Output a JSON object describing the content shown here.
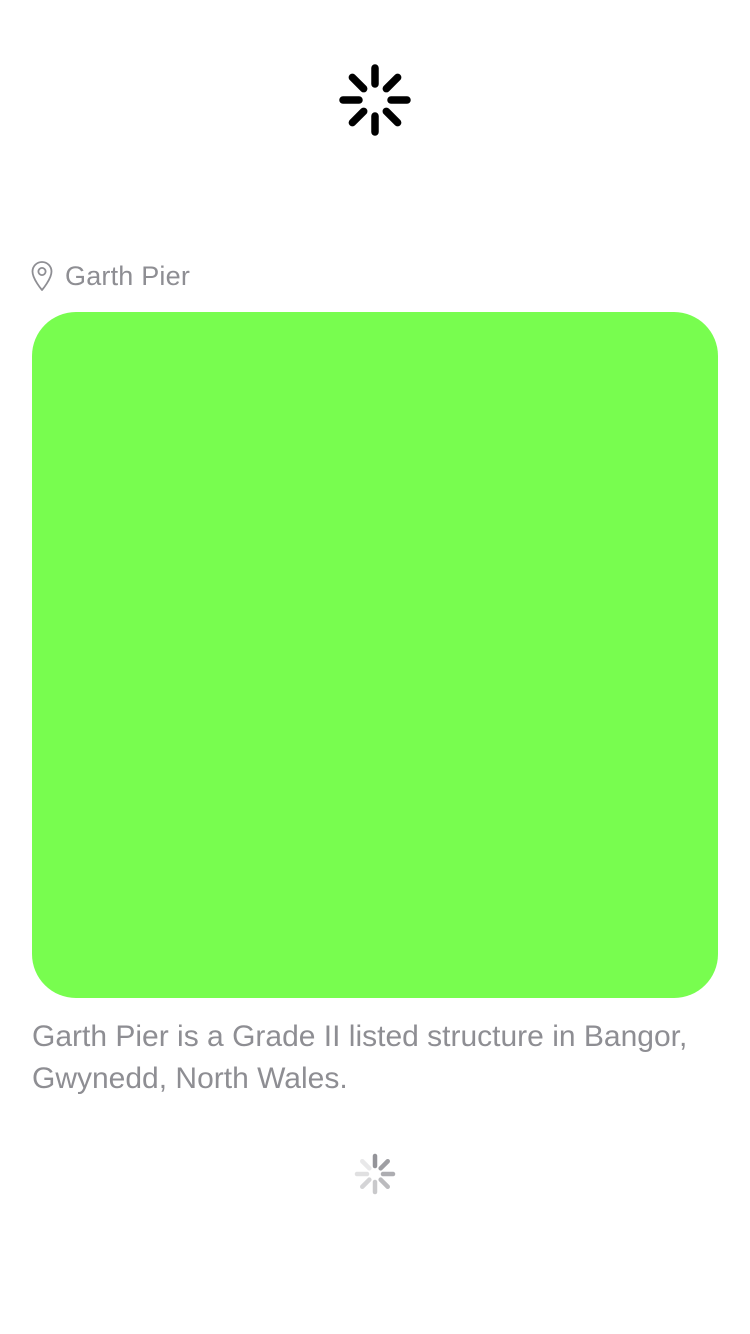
{
  "loading": {
    "top_spinner_icon": "activity-indicator",
    "bottom_spinner_icon": "activity-indicator"
  },
  "location": {
    "icon": "map-pin",
    "name": "Garth Pier"
  },
  "media": {
    "color": "#78fd4f"
  },
  "description": "Garth Pier is a Grade II listed structure in Bangor, Gwynedd, North Wales.",
  "colors": {
    "secondary_text": "#8e8e93",
    "spinner_dark": "#000000",
    "spinner_light": "#8e8e93"
  }
}
